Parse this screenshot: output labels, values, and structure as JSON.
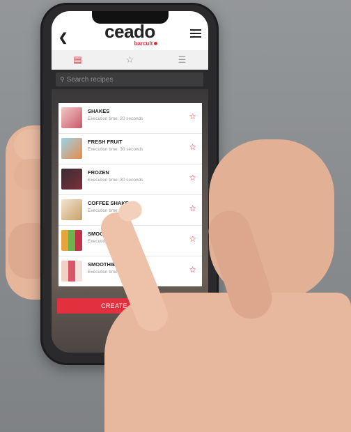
{
  "app": {
    "logo": "ceado",
    "logo_sub": "barcult"
  },
  "search": {
    "placeholder": "Search recipes"
  },
  "tabs": [
    "recipes-icon",
    "favorites-icon",
    "list-icon"
  ],
  "recipes": [
    {
      "title": "SHAKES",
      "subtitle": "Execution time: 20 seconds",
      "thumb": "#c85a6a"
    },
    {
      "title": "FRESH FRUIT",
      "subtitle": "Execution time: 30 seconds",
      "thumb": "#e98b4a"
    },
    {
      "title": "FROZEN",
      "subtitle": "Execution time: 30 seconds",
      "thumb": "#7a2f3c"
    },
    {
      "title": "COFFEE SHAKE",
      "subtitle": "Execution time:",
      "thumb": "#c9a06a"
    },
    {
      "title": "SMOOTHIE",
      "subtitle": "Execution time:",
      "thumb": "#6bb34a"
    },
    {
      "title": "SMOOTHIE2",
      "subtitle": "Execution time: 25 seconds",
      "thumb": "#d8566a"
    }
  ],
  "create_button": "CREATE A RECIPE",
  "colors": {
    "accent": "#e3303e"
  }
}
